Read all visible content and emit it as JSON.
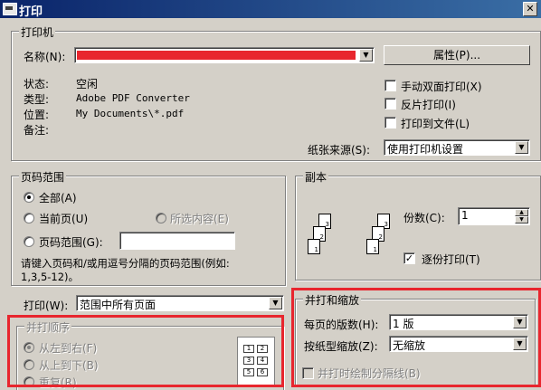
{
  "window": {
    "title": "打印",
    "close_glyph": "✕"
  },
  "printer": {
    "group_label": "打印机",
    "name_label": "名称(N):",
    "properties_button": "属性(P)...",
    "status_label": "状态:",
    "status_value": "空闲",
    "type_label": "类型:",
    "type_value": "Adobe PDF Converter",
    "location_label": "位置:",
    "location_value": "My Documents\\*.pdf",
    "comment_label": "备注:",
    "manual_duplex": "手动双面打印(X)",
    "reverse_print": "反片打印(I)",
    "print_to_file": "打印到文件(L)",
    "paper_source_label": "纸张来源(S):",
    "paper_source_value": "使用打印机设置",
    "redaction_color": "#e8262e"
  },
  "page_range": {
    "group_label": "页码范围",
    "all": "全部(A)",
    "current_page": "当前页(U)",
    "selection": "所选内容(E)",
    "pages": "页码范围(G):",
    "hint_line1": "请键入页码和/或用逗号分隔的页码范围(例如:",
    "hint_line2": "1,3,5-12)。"
  },
  "copies": {
    "group_label": "副本",
    "count_label": "份数(C):",
    "count_value": "1",
    "collate": "逐份打印(T)"
  },
  "print_what": {
    "label": "打印(W):",
    "value": "范围中所有页面"
  },
  "zoom": {
    "group_label": "并打和缩放",
    "pages_per_sheet_label": "每页的版数(H):",
    "pages_per_sheet_value": "1 版",
    "scale_label": "按纸型缩放(Z):",
    "scale_value": "无缩放",
    "draw_divider": "并打时绘制分隔线(B)"
  },
  "order": {
    "group_label": "并打顺序",
    "left_to_right": "从左到右(F)",
    "top_to_bottom": "从上到下(B)",
    "repeat": "重复(R)"
  },
  "highlight_color": "#e8262e"
}
